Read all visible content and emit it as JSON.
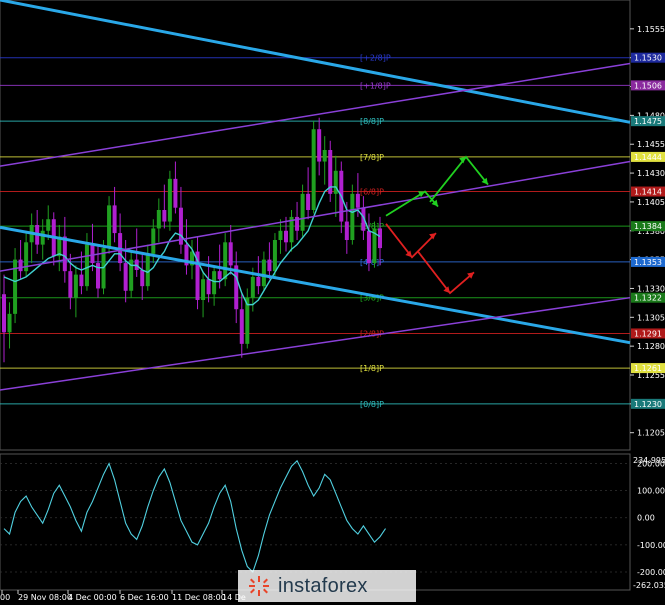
{
  "chart_data": {
    "type": "candlestick",
    "price_axis": {
      "ylim": [
        1.119,
        1.158
      ],
      "ticks": [
        1.1555,
        1.153,
        1.1505,
        1.148,
        1.1455,
        1.143,
        1.1405,
        1.138,
        1.1355,
        1.133,
        1.1305,
        1.128,
        1.1255,
        1.123,
        1.1205
      ]
    },
    "price_tag_values": [
      1.153,
      1.1506,
      1.1475,
      1.1444,
      1.1414,
      1.1384,
      1.1353,
      1.1322,
      1.1291,
      1.1261,
      1.123
    ],
    "price_tag_colors": [
      "#1e2a9e",
      "#8a2a9e",
      "#1a7a7a",
      "#e0e040",
      "#b01a1a",
      "#1a7a1a",
      "#1e6ad0",
      "#1a7a1a",
      "#b01a1a",
      "#e0e040",
      "#1a7a7a"
    ],
    "murrey_levels": [
      {
        "label": "[+2/8]P",
        "price": 1.153,
        "color": "#2a3ad0"
      },
      {
        "label": "[+1/8]P",
        "price": 1.1506,
        "color": "#9a3ad0"
      },
      {
        "label": "[8/8]P",
        "price": 1.1475,
        "color": "#30c0c0"
      },
      {
        "label": "[7/8]P",
        "price": 1.1444,
        "color": "#e0e040"
      },
      {
        "label": "[6/8]P",
        "price": 1.1414,
        "color": "#d02020"
      },
      {
        "label": "[5/8]P",
        "price": 1.1384,
        "color": "#20b020"
      },
      {
        "label": "[4/8]P",
        "price": 1.1353,
        "color": "#3070e0"
      },
      {
        "label": "[3/8]P",
        "price": 1.1322,
        "color": "#20b020"
      },
      {
        "label": "[2/8]P",
        "price": 1.1291,
        "color": "#d02020"
      },
      {
        "label": "[1/8]P",
        "price": 1.1261,
        "color": "#e0e040"
      },
      {
        "label": "[0/8]P",
        "price": 1.123,
        "color": "#30c0c0"
      }
    ],
    "x_labels": [
      "00",
      "29 Nov 08:00",
      "4 Dec 00:00",
      "6 Dec 16:00",
      "11 Dec 08:00",
      "14 De"
    ],
    "candles": [
      [
        1.1325,
        1.1342,
        1.1266,
        1.1292
      ],
      [
        1.1292,
        1.1318,
        1.1278,
        1.1308
      ],
      [
        1.1308,
        1.1365,
        1.13,
        1.1355
      ],
      [
        1.1355,
        1.1372,
        1.1338,
        1.1345
      ],
      [
        1.1345,
        1.138,
        1.134,
        1.137
      ],
      [
        1.137,
        1.1395,
        1.1352,
        1.1385
      ],
      [
        1.1385,
        1.1398,
        1.136,
        1.1368
      ],
      [
        1.1368,
        1.139,
        1.1355,
        1.138
      ],
      [
        1.138,
        1.1402,
        1.1372,
        1.139
      ],
      [
        1.139,
        1.1396,
        1.135,
        1.1358
      ],
      [
        1.1358,
        1.1385,
        1.1345,
        1.1375
      ],
      [
        1.1375,
        1.1392,
        1.1335,
        1.1345
      ],
      [
        1.1345,
        1.136,
        1.1312,
        1.1322
      ],
      [
        1.1322,
        1.135,
        1.1305,
        1.1342
      ],
      [
        1.1342,
        1.1362,
        1.1325,
        1.1332
      ],
      [
        1.1332,
        1.1378,
        1.1328,
        1.1368
      ],
      [
        1.1368,
        1.1386,
        1.1345,
        1.1352
      ],
      [
        1.1352,
        1.1368,
        1.1322,
        1.133
      ],
      [
        1.133,
        1.1372,
        1.1325,
        1.1365
      ],
      [
        1.1365,
        1.141,
        1.136,
        1.1402
      ],
      [
        1.1402,
        1.1418,
        1.137,
        1.1378
      ],
      [
        1.1378,
        1.1395,
        1.1345,
        1.1352
      ],
      [
        1.1352,
        1.1372,
        1.1318,
        1.1328
      ],
      [
        1.1328,
        1.1362,
        1.1322,
        1.1355
      ],
      [
        1.1355,
        1.1382,
        1.134,
        1.1346
      ],
      [
        1.1346,
        1.136,
        1.132,
        1.1332
      ],
      [
        1.1332,
        1.1368,
        1.1328,
        1.136
      ],
      [
        1.136,
        1.139,
        1.1352,
        1.1382
      ],
      [
        1.1382,
        1.1408,
        1.137,
        1.1398
      ],
      [
        1.1398,
        1.142,
        1.1382,
        1.1388
      ],
      [
        1.1388,
        1.1432,
        1.138,
        1.1425
      ],
      [
        1.1425,
        1.144,
        1.1395,
        1.14
      ],
      [
        1.14,
        1.1418,
        1.136,
        1.1368
      ],
      [
        1.1368,
        1.139,
        1.1342,
        1.135
      ],
      [
        1.135,
        1.1372,
        1.1338,
        1.1362
      ],
      [
        1.1362,
        1.1375,
        1.1312,
        1.132
      ],
      [
        1.132,
        1.1345,
        1.1305,
        1.1338
      ],
      [
        1.1338,
        1.1358,
        1.1318,
        1.1325
      ],
      [
        1.1325,
        1.135,
        1.1315,
        1.1345
      ],
      [
        1.1345,
        1.1368,
        1.133,
        1.1338
      ],
      [
        1.1338,
        1.1378,
        1.1332,
        1.137
      ],
      [
        1.137,
        1.1385,
        1.1342,
        1.135
      ],
      [
        1.135,
        1.1362,
        1.13,
        1.1312
      ],
      [
        1.1312,
        1.1325,
        1.127,
        1.1282
      ],
      [
        1.1282,
        1.133,
        1.1278,
        1.1322
      ],
      [
        1.1322,
        1.1348,
        1.131,
        1.134
      ],
      [
        1.134,
        1.1358,
        1.1325,
        1.1332
      ],
      [
        1.1332,
        1.1362,
        1.1328,
        1.1355
      ],
      [
        1.1355,
        1.137,
        1.1338,
        1.1345
      ],
      [
        1.1345,
        1.1378,
        1.134,
        1.1372
      ],
      [
        1.1372,
        1.139,
        1.136,
        1.138
      ],
      [
        1.138,
        1.1392,
        1.1362,
        1.137
      ],
      [
        1.137,
        1.1398,
        1.1362,
        1.1392
      ],
      [
        1.1392,
        1.1405,
        1.1372,
        1.138
      ],
      [
        1.138,
        1.142,
        1.1375,
        1.1412
      ],
      [
        1.1412,
        1.1435,
        1.139,
        1.1398
      ],
      [
        1.1398,
        1.1475,
        1.1395,
        1.1468
      ],
      [
        1.1468,
        1.1478,
        1.1428,
        1.144
      ],
      [
        1.144,
        1.1462,
        1.142,
        1.145
      ],
      [
        1.145,
        1.1458,
        1.1405,
        1.1412
      ],
      [
        1.1412,
        1.1445,
        1.1392,
        1.1432
      ],
      [
        1.1432,
        1.144,
        1.1378,
        1.1388
      ],
      [
        1.1388,
        1.1405,
        1.136,
        1.1372
      ],
      [
        1.1372,
        1.142,
        1.1368,
        1.1412
      ],
      [
        1.1412,
        1.143,
        1.1392,
        1.14
      ],
      [
        1.14,
        1.141,
        1.1372,
        1.138
      ],
      [
        1.138,
        1.1395,
        1.1345,
        1.1352
      ],
      [
        1.1352,
        1.1388,
        1.1348,
        1.1382
      ],
      [
        1.1382,
        1.1392,
        1.135,
        1.1365
      ]
    ],
    "moving_average": [
      1.134,
      1.1338,
      1.1336,
      1.1338,
      1.134,
      1.1344,
      1.1348,
      1.1352,
      1.1356,
      1.1358,
      1.136,
      1.1358,
      1.1352,
      1.1348,
      1.1346,
      1.1348,
      1.135,
      1.1348,
      1.1348,
      1.1354,
      1.136,
      1.136,
      1.1354,
      1.135,
      1.135,
      1.1346,
      1.1344,
      1.1348,
      1.1356,
      1.1362,
      1.1372,
      1.1378,
      1.1376,
      1.137,
      1.1364,
      1.1354,
      1.1344,
      1.1338,
      1.1336,
      1.1336,
      1.134,
      1.1344,
      1.134,
      1.1326,
      1.1316,
      1.1316,
      1.132,
      1.1328,
      1.1336,
      1.1344,
      1.1352,
      1.1358,
      1.1364,
      1.1368,
      1.1374,
      1.138,
      1.1392,
      1.1404,
      1.1414,
      1.1418,
      1.1418,
      1.141,
      1.1398,
      1.1396,
      1.1398,
      1.1392,
      1.138,
      1.1378,
      1.1375
    ],
    "oscillator": {
      "ylim": [
        -200,
        234.9955
      ],
      "ticks": [
        200,
        100,
        0,
        -100,
        -200
      ],
      "top_label": "234.9955",
      "bottom_label": "-262.035",
      "values": [
        -40,
        -60,
        20,
        60,
        80,
        40,
        10,
        -20,
        30,
        90,
        120,
        80,
        40,
        -10,
        -50,
        20,
        60,
        110,
        160,
        200,
        140,
        60,
        -20,
        -60,
        -80,
        -30,
        40,
        100,
        150,
        180,
        130,
        60,
        -10,
        -50,
        -90,
        -100,
        -60,
        -20,
        40,
        90,
        120,
        60,
        -40,
        -120,
        -180,
        -200,
        -140,
        -60,
        10,
        60,
        110,
        150,
        190,
        210,
        170,
        120,
        80,
        110,
        160,
        140,
        90,
        40,
        -10,
        -40,
        -60,
        -30,
        -60,
        -90,
        -70,
        -40
      ],
      "line_color": "#50d0e0"
    },
    "trend_lines_color": "#2aa8e8",
    "channel_lines_color": "#8a40d8",
    "up_arrow_color": "#20d020",
    "down_arrow_color": "#e02020",
    "bull_color": "#20a020",
    "bear_color": "#b020d0",
    "ma_color": "#40d0d0"
  },
  "watermark": {
    "brand": "instaforex"
  }
}
